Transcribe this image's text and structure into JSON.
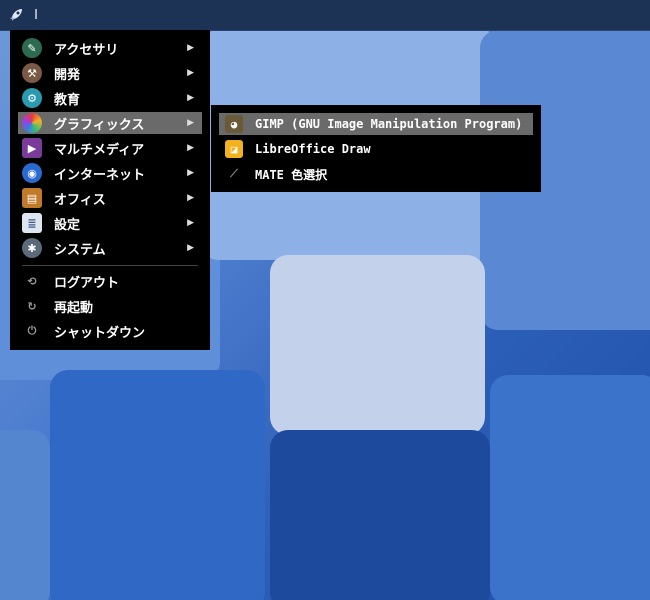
{
  "panel": {
    "launcher_icon": "rocket-icon",
    "second_label": "I"
  },
  "menu": {
    "items": [
      {
        "label": "アクセサリ",
        "icon": "accessories-icon",
        "color": "#3a7a5a",
        "arrow": "▶"
      },
      {
        "label": "開発",
        "icon": "hammer-icon",
        "color": "#7a5a44",
        "arrow": "▶"
      },
      {
        "label": "教育",
        "icon": "education-icon",
        "color": "#2a9ab0",
        "arrow": "▶"
      },
      {
        "label": "グラフィックス",
        "icon": "graphics-icon",
        "color": "#e05a3a",
        "arrow": "▶"
      },
      {
        "label": "マルチメディア",
        "icon": "multimedia-icon",
        "color": "#7a3a9a",
        "arrow": "▶"
      },
      {
        "label": "インターネット",
        "icon": "internet-icon",
        "color": "#2a6ad0",
        "arrow": "▶"
      },
      {
        "label": "オフィス",
        "icon": "office-icon",
        "color": "#c07a2a",
        "arrow": "▶"
      },
      {
        "label": "設定",
        "icon": "settings-icon",
        "color": "#6a8ab0",
        "arrow": "▶"
      },
      {
        "label": "システム",
        "icon": "system-icon",
        "color": "#6a7a8a",
        "arrow": "▶"
      }
    ],
    "session": [
      {
        "label": "ログアウト",
        "icon": "logout-icon"
      },
      {
        "label": "再起動",
        "icon": "restart-icon"
      },
      {
        "label": "シャットダウン",
        "icon": "power-icon"
      }
    ]
  },
  "submenu": {
    "items": [
      {
        "label": "GIMP (GNU Image Manipulation Program)",
        "icon": "gimp-icon"
      },
      {
        "label": "LibreOffice Draw",
        "icon": "libreoffice-draw-icon"
      },
      {
        "label": "MATE 色選択",
        "icon": "color-picker-icon"
      }
    ]
  }
}
